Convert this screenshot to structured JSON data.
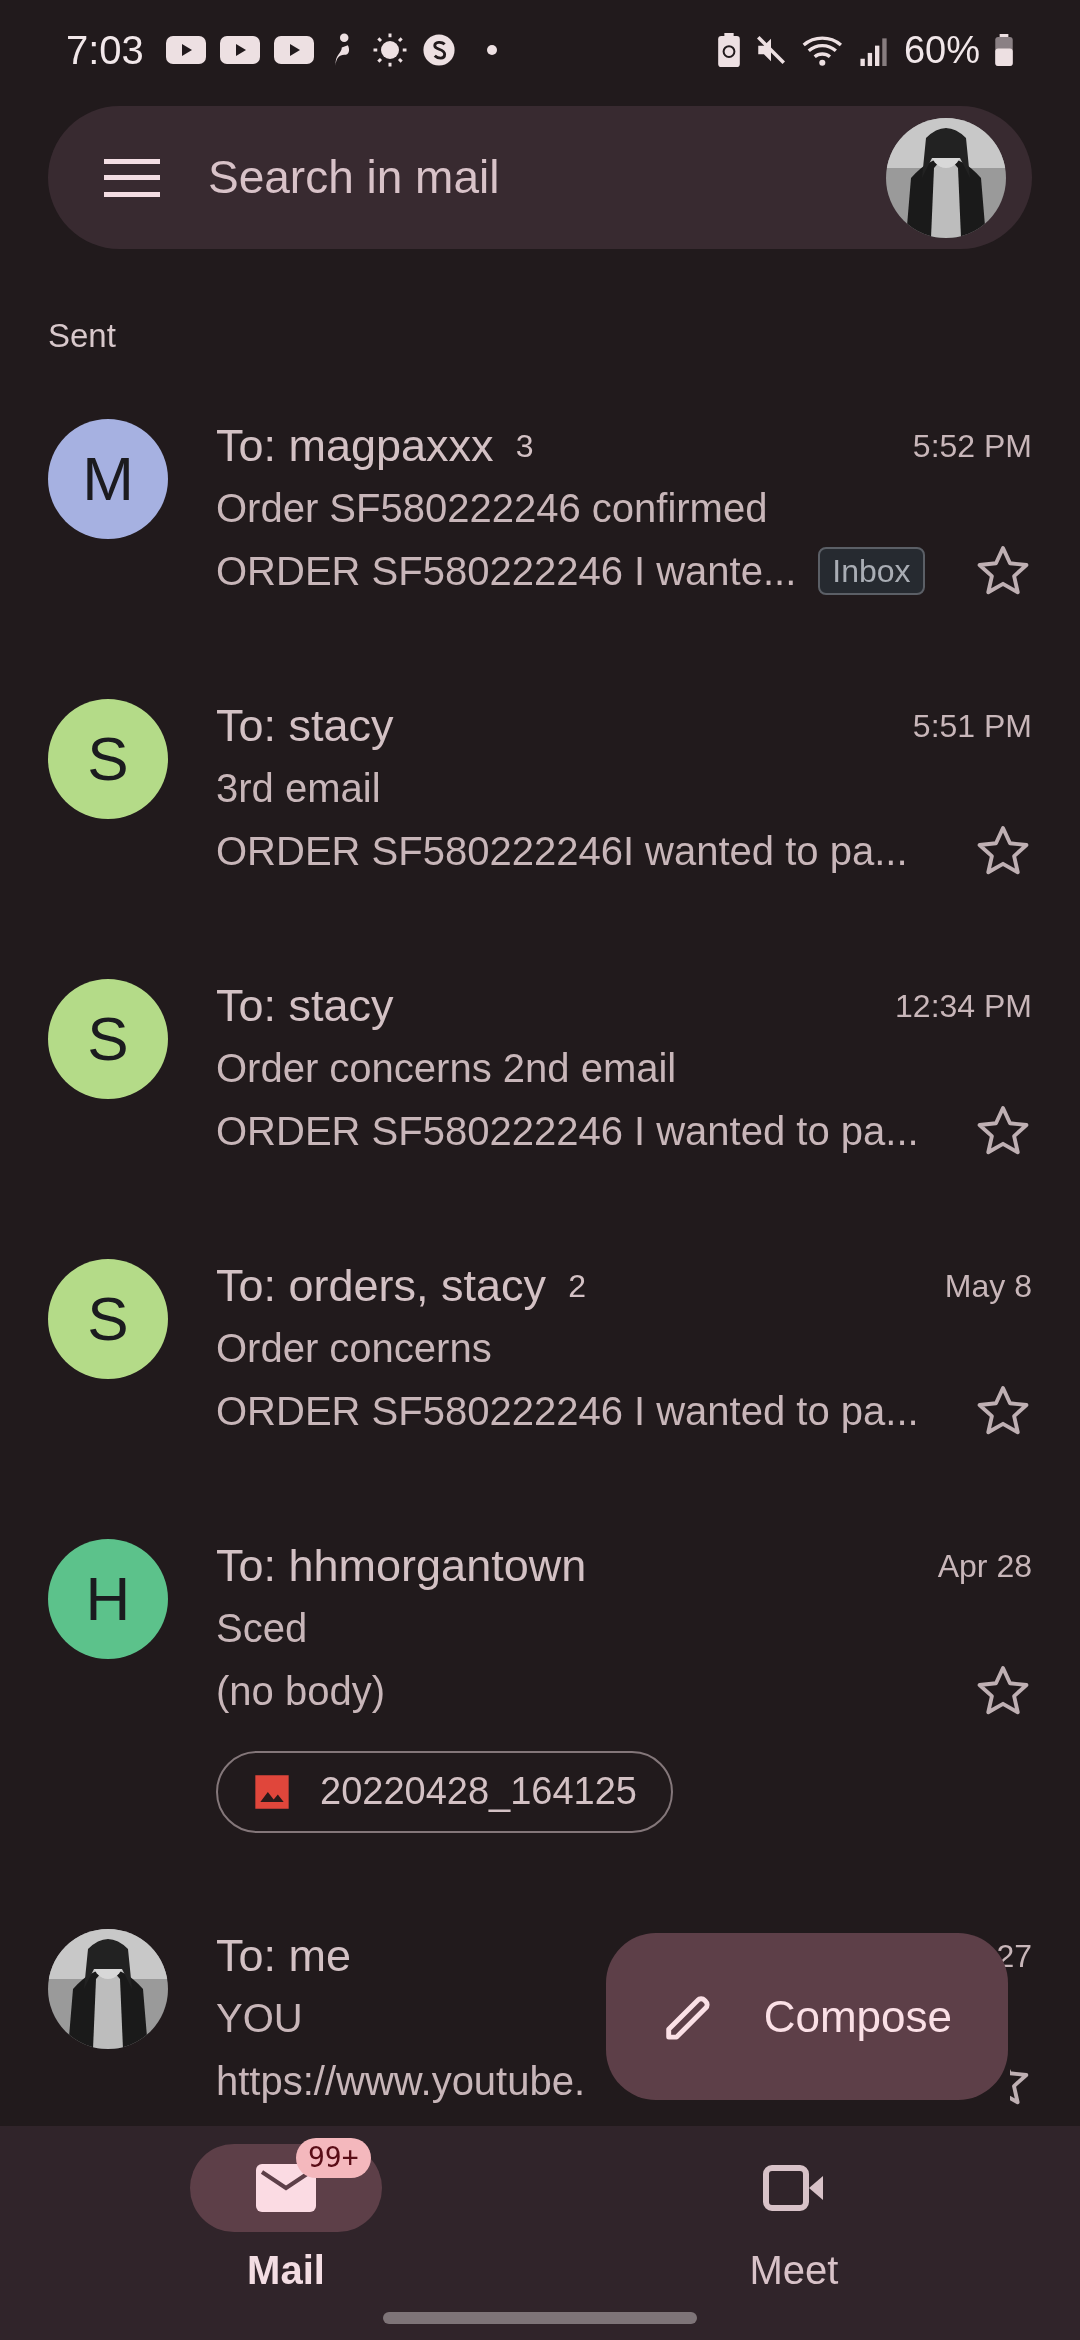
{
  "status_bar": {
    "time": "7:03",
    "battery": "60%"
  },
  "search": {
    "placeholder": "Search in mail"
  },
  "section": "Sent",
  "threads": [
    {
      "avatar": {
        "kind": "letter",
        "letter": "M",
        "color": "#a6b1e1"
      },
      "to": "To: magpaxxx",
      "count": "3",
      "time": "5:52 PM",
      "subject": "Order SF580222246 confirmed",
      "snippet": "ORDER SF580222246 I wante...",
      "label": "Inbox",
      "starred": false
    },
    {
      "avatar": {
        "kind": "letter",
        "letter": "S",
        "color": "#b4db88"
      },
      "to": "To: stacy",
      "time": "5:51 PM",
      "subject": "3rd email",
      "snippet": "ORDER SF580222246I wanted to pa...",
      "starred": false
    },
    {
      "avatar": {
        "kind": "letter",
        "letter": "S",
        "color": "#b4db88"
      },
      "to": "To: stacy",
      "time": "12:34 PM",
      "subject": "Order concerns 2nd email",
      "snippet": "ORDER SF580222246 I wanted to pa...",
      "starred": false
    },
    {
      "avatar": {
        "kind": "letter",
        "letter": "S",
        "color": "#b4db88"
      },
      "to": "To: orders, stacy",
      "count": "2",
      "time": "May 8",
      "subject": "Order concerns",
      "snippet": "ORDER SF580222246 I wanted to pa...",
      "starred": false
    },
    {
      "avatar": {
        "kind": "letter",
        "letter": "H",
        "color": "#5cc28b"
      },
      "to": "To: hhmorgantown",
      "time": "Apr 28",
      "subject": "Sced",
      "snippet": "(no body)",
      "attachment": "20220428_164125",
      "starred": false
    },
    {
      "to": "To: me",
      "time": "27",
      "subject": "YOU",
      "snippet": "https://www.youtube.",
      "starred": false
    }
  ],
  "compose": "Compose",
  "nav": [
    {
      "label": "Mail",
      "kind": "mail",
      "badge": "99+",
      "selected": true
    },
    {
      "label": "Meet",
      "kind": "video",
      "selected": false
    }
  ]
}
